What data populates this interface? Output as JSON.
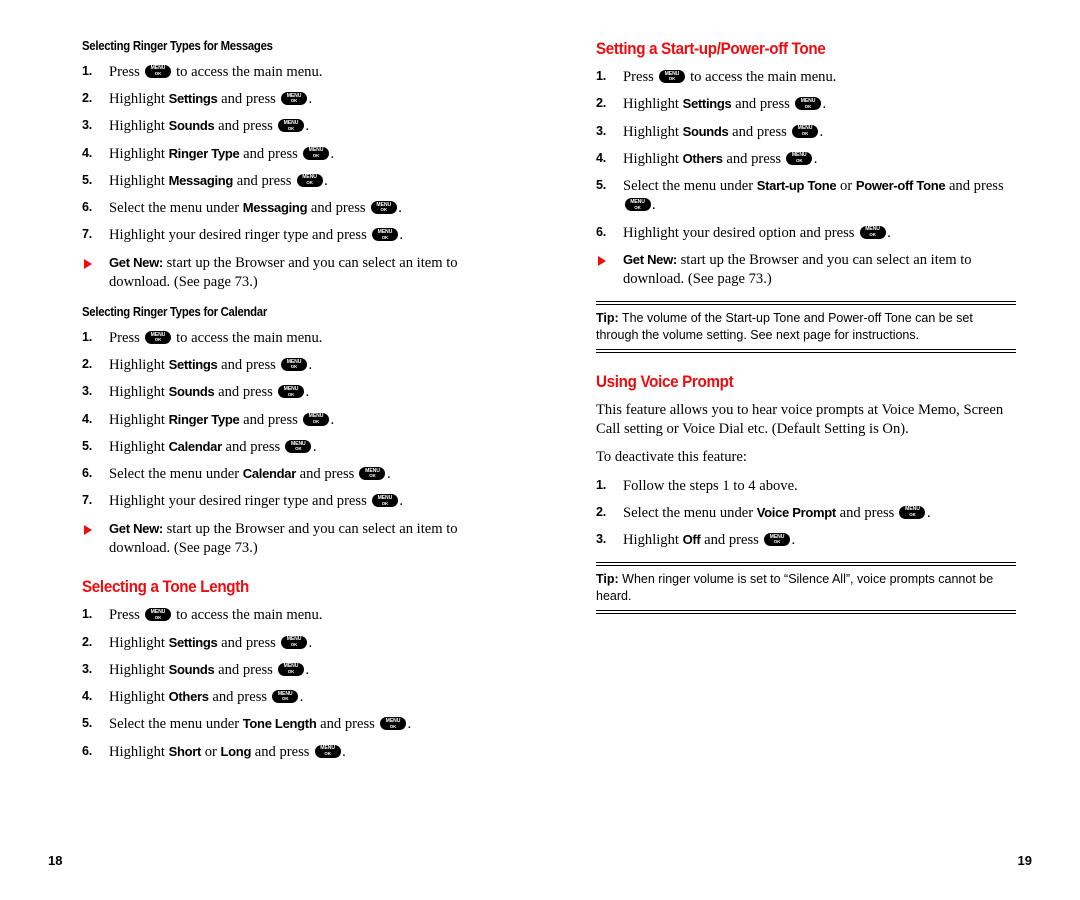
{
  "key_glyph": {
    "top": "MENU",
    "bottom": "OK"
  },
  "colors": {
    "heading_red": "#ee0c10",
    "text_black": "#000000",
    "page_background": "#ffffff"
  },
  "left_page": {
    "folio": "18",
    "sections": [
      {
        "heading": "Selecting Ringer Types for Messages",
        "heading_style": "black",
        "steps": [
          {
            "num": "1.",
            "parts": [
              {
                "t": "text",
                "v": "Press "
              },
              {
                "t": "key"
              },
              {
                "t": "text",
                "v": " to access the main menu."
              }
            ]
          },
          {
            "num": "2.",
            "parts": [
              {
                "t": "text",
                "v": "Highlight "
              },
              {
                "t": "bold",
                "v": "Settings"
              },
              {
                "t": "text",
                "v": " and press "
              },
              {
                "t": "key"
              },
              {
                "t": "text",
                "v": "."
              }
            ]
          },
          {
            "num": "3.",
            "parts": [
              {
                "t": "text",
                "v": "Highlight "
              },
              {
                "t": "bold",
                "v": "Sounds"
              },
              {
                "t": "text",
                "v": " and press "
              },
              {
                "t": "key"
              },
              {
                "t": "text",
                "v": "."
              }
            ]
          },
          {
            "num": "4.",
            "parts": [
              {
                "t": "text",
                "v": "Highlight "
              },
              {
                "t": "bold",
                "v": "Ringer Type"
              },
              {
                "t": "text",
                "v": " and press "
              },
              {
                "t": "key"
              },
              {
                "t": "text",
                "v": "."
              }
            ]
          },
          {
            "num": "5.",
            "parts": [
              {
                "t": "text",
                "v": "Highlight "
              },
              {
                "t": "bold",
                "v": "Messaging"
              },
              {
                "t": "text",
                "v": " and press "
              },
              {
                "t": "key"
              },
              {
                "t": "text",
                "v": "."
              }
            ]
          },
          {
            "num": "6.",
            "parts": [
              {
                "t": "text",
                "v": "Select the menu under "
              },
              {
                "t": "bold",
                "v": "Messaging"
              },
              {
                "t": "text",
                "v": " and press "
              },
              {
                "t": "key"
              },
              {
                "t": "text",
                "v": "."
              }
            ]
          },
          {
            "num": "7.",
            "parts": [
              {
                "t": "text",
                "v": "Highlight your desired ringer type and press "
              },
              {
                "t": "key"
              },
              {
                "t": "text",
                "v": "."
              }
            ]
          }
        ],
        "bullets": [
          {
            "parts": [
              {
                "t": "bold",
                "v": "Get New:"
              },
              {
                "t": "text",
                "v": " start up the Browser and you can select an item to download. (See page 73.)"
              }
            ]
          }
        ]
      },
      {
        "heading": "Selecting Ringer Types for Calendar",
        "heading_style": "black",
        "steps": [
          {
            "num": "1.",
            "parts": [
              {
                "t": "text",
                "v": "Press "
              },
              {
                "t": "key"
              },
              {
                "t": "text",
                "v": " to access the main menu."
              }
            ]
          },
          {
            "num": "2.",
            "parts": [
              {
                "t": "text",
                "v": "Highlight "
              },
              {
                "t": "bold",
                "v": "Settings"
              },
              {
                "t": "text",
                "v": " and press "
              },
              {
                "t": "key"
              },
              {
                "t": "text",
                "v": "."
              }
            ]
          },
          {
            "num": "3.",
            "parts": [
              {
                "t": "text",
                "v": "Highlight "
              },
              {
                "t": "bold",
                "v": "Sounds"
              },
              {
                "t": "text",
                "v": " and press "
              },
              {
                "t": "key"
              },
              {
                "t": "text",
                "v": "."
              }
            ]
          },
          {
            "num": "4.",
            "parts": [
              {
                "t": "text",
                "v": "Highlight "
              },
              {
                "t": "bold",
                "v": "Ringer Type"
              },
              {
                "t": "text",
                "v": " and press "
              },
              {
                "t": "key"
              },
              {
                "t": "text",
                "v": "."
              }
            ]
          },
          {
            "num": "5.",
            "parts": [
              {
                "t": "text",
                "v": "Highlight "
              },
              {
                "t": "bold",
                "v": "Calendar"
              },
              {
                "t": "text",
                "v": " and press "
              },
              {
                "t": "key"
              },
              {
                "t": "text",
                "v": "."
              }
            ]
          },
          {
            "num": "6.",
            "parts": [
              {
                "t": "text",
                "v": "Select the menu under "
              },
              {
                "t": "bold",
                "v": "Calendar"
              },
              {
                "t": "text",
                "v": " and press "
              },
              {
                "t": "key"
              },
              {
                "t": "text",
                "v": "."
              }
            ]
          },
          {
            "num": "7.",
            "parts": [
              {
                "t": "text",
                "v": "Highlight your desired ringer type and press "
              },
              {
                "t": "key"
              },
              {
                "t": "text",
                "v": "."
              }
            ]
          }
        ],
        "bullets": [
          {
            "parts": [
              {
                "t": "bold",
                "v": "Get New:"
              },
              {
                "t": "text",
                "v": " start up the Browser and you can select an item to download. (See page 73.)"
              }
            ]
          }
        ]
      },
      {
        "heading": "Selecting a Tone Length",
        "heading_style": "red",
        "steps": [
          {
            "num": "1.",
            "parts": [
              {
                "t": "text",
                "v": "Press "
              },
              {
                "t": "key"
              },
              {
                "t": "text",
                "v": " to access the main menu."
              }
            ]
          },
          {
            "num": "2.",
            "parts": [
              {
                "t": "text",
                "v": "Highlight "
              },
              {
                "t": "bold",
                "v": "Settings"
              },
              {
                "t": "text",
                "v": " and press "
              },
              {
                "t": "key"
              },
              {
                "t": "text",
                "v": "."
              }
            ]
          },
          {
            "num": "3.",
            "parts": [
              {
                "t": "text",
                "v": "Highlight "
              },
              {
                "t": "bold",
                "v": "Sounds"
              },
              {
                "t": "text",
                "v": " and press "
              },
              {
                "t": "key"
              },
              {
                "t": "text",
                "v": "."
              }
            ]
          },
          {
            "num": "4.",
            "parts": [
              {
                "t": "text",
                "v": "Highlight "
              },
              {
                "t": "bold",
                "v": "Others"
              },
              {
                "t": "text",
                "v": " and press "
              },
              {
                "t": "key"
              },
              {
                "t": "text",
                "v": "."
              }
            ]
          },
          {
            "num": "5.",
            "parts": [
              {
                "t": "text",
                "v": "Select the menu under "
              },
              {
                "t": "bold",
                "v": "Tone Length"
              },
              {
                "t": "text",
                "v": " and press "
              },
              {
                "t": "key"
              },
              {
                "t": "text",
                "v": "."
              }
            ]
          },
          {
            "num": "6.",
            "parts": [
              {
                "t": "text",
                "v": "Highlight "
              },
              {
                "t": "bold",
                "v": "Short"
              },
              {
                "t": "text",
                "v": " or "
              },
              {
                "t": "bold",
                "v": "Long"
              },
              {
                "t": "text",
                "v": " and press "
              },
              {
                "t": "key"
              },
              {
                "t": "text",
                "v": "."
              }
            ]
          }
        ],
        "bullets": []
      }
    ]
  },
  "right_page": {
    "folio": "19",
    "sections": [
      {
        "heading": "Setting a Start-up/Power-off Tone",
        "heading_style": "red",
        "steps": [
          {
            "num": "1.",
            "parts": [
              {
                "t": "text",
                "v": "Press "
              },
              {
                "t": "key"
              },
              {
                "t": "text",
                "v": " to access the main menu."
              }
            ]
          },
          {
            "num": "2.",
            "parts": [
              {
                "t": "text",
                "v": "Highlight "
              },
              {
                "t": "bold",
                "v": "Settings"
              },
              {
                "t": "text",
                "v": " and press "
              },
              {
                "t": "key"
              },
              {
                "t": "text",
                "v": "."
              }
            ]
          },
          {
            "num": "3.",
            "parts": [
              {
                "t": "text",
                "v": "Highlight "
              },
              {
                "t": "bold",
                "v": "Sounds"
              },
              {
                "t": "text",
                "v": " and press "
              },
              {
                "t": "key"
              },
              {
                "t": "text",
                "v": "."
              }
            ]
          },
          {
            "num": "4.",
            "parts": [
              {
                "t": "text",
                "v": "Highlight "
              },
              {
                "t": "bold",
                "v": "Others"
              },
              {
                "t": "text",
                "v": " and press "
              },
              {
                "t": "key"
              },
              {
                "t": "text",
                "v": "."
              }
            ]
          },
          {
            "num": "5.",
            "parts": [
              {
                "t": "text",
                "v": "Select the menu under "
              },
              {
                "t": "bold",
                "v": "Start-up Tone"
              },
              {
                "t": "text",
                "v": " or "
              },
              {
                "t": "bold",
                "v": "Power-off Tone"
              },
              {
                "t": "text",
                "v": " and press "
              },
              {
                "t": "key"
              },
              {
                "t": "text",
                "v": "."
              }
            ]
          },
          {
            "num": "6.",
            "parts": [
              {
                "t": "text",
                "v": "Highlight your desired option and press "
              },
              {
                "t": "key"
              },
              {
                "t": "text",
                "v": "."
              }
            ]
          }
        ],
        "bullets": [
          {
            "parts": [
              {
                "t": "bold",
                "v": "Get New:"
              },
              {
                "t": "text",
                "v": " start up the Browser and you can select an item to download. (See page 73.)"
              }
            ]
          }
        ],
        "tip": {
          "label": "Tip:",
          "text": " The volume of the Start-up Tone and Power-off Tone can be set through the volume setting. See next page for instructions."
        }
      },
      {
        "heading": "Using Voice Prompt",
        "heading_style": "red",
        "paragraphs": [
          "This feature allows you to hear voice prompts at Voice Memo, Screen Call setting or Voice Dial etc. (Default Setting is On).",
          "To deactivate this feature:"
        ],
        "steps": [
          {
            "num": "1.",
            "parts": [
              {
                "t": "text",
                "v": "Follow the steps 1 to 4 above."
              }
            ]
          },
          {
            "num": "2.",
            "parts": [
              {
                "t": "text",
                "v": "Select the menu under "
              },
              {
                "t": "bold",
                "v": "Voice Prompt"
              },
              {
                "t": "text",
                "v": " and press "
              },
              {
                "t": "key"
              },
              {
                "t": "text",
                "v": "."
              }
            ]
          },
          {
            "num": "3.",
            "parts": [
              {
                "t": "text",
                "v": "Highlight "
              },
              {
                "t": "bold",
                "v": "Off"
              },
              {
                "t": "text",
                "v": " and press "
              },
              {
                "t": "key"
              },
              {
                "t": "text",
                "v": "."
              }
            ]
          }
        ],
        "bullets": [],
        "tip": {
          "label": "Tip:",
          "text": " When ringer volume is set to “Silence All”, voice prompts cannot be heard."
        }
      }
    ]
  }
}
